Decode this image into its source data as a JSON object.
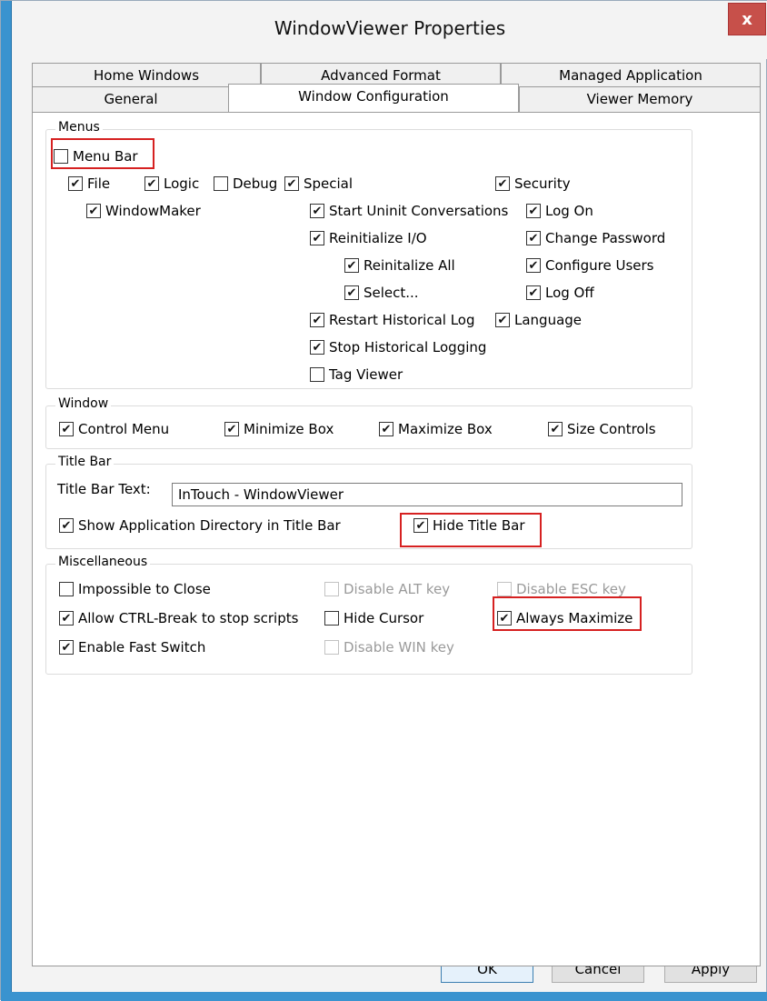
{
  "window": {
    "title": "WindowViewer Properties",
    "close_glyph": "x"
  },
  "tabs": {
    "row1": [
      "Home Windows",
      "Advanced Format",
      "Managed Application"
    ],
    "row2": [
      "General",
      "Window Configuration",
      "Viewer Memory"
    ]
  },
  "menus": {
    "legend": "Menus",
    "menu_bar": "Menu Bar",
    "file": "File",
    "logic": "Logic",
    "debug": "Debug",
    "special": "Special",
    "security": "Security",
    "window_maker": "WindowMaker",
    "start_unint": "Start Uninit Conversations",
    "reinit_io": "Reinitialize I/O",
    "reinit_all": "Reinitalize All",
    "select": "Select...",
    "restart_hist": "Restart Historical Log",
    "stop_hist": "Stop Historical Logging",
    "tag_viewer": "Tag Viewer",
    "log_on": "Log On",
    "change_password": "Change Password",
    "configure_users": "Configure Users",
    "log_off": "Log Off",
    "language": "Language"
  },
  "window_group": {
    "legend": "Window",
    "control_menu": "Control Menu",
    "minimize_box": "Minimize Box",
    "maximize_box": "Maximize Box",
    "size_controls": "Size Controls"
  },
  "titlebar_group": {
    "legend": "Title Bar",
    "text_label": "Title Bar Text:",
    "text_value": "InTouch - WindowViewer",
    "show_app_dir": "Show Application Directory in Title Bar",
    "hide_title_bar": "Hide Title Bar"
  },
  "misc": {
    "legend": "Miscellaneous",
    "impossible_close": "Impossible to Close",
    "allow_ctrl_break": "Allow CTRL-Break to stop scripts",
    "enable_fast_switch": "Enable Fast Switch",
    "disable_alt": "Disable ALT key",
    "hide_cursor": "Hide Cursor",
    "disable_win": "Disable WIN key",
    "disable_esc": "Disable ESC key",
    "always_maximize": "Always Maximize"
  },
  "buttons": {
    "ok": "OK",
    "cancel": "Cancel",
    "apply": "Apply"
  },
  "check_glyph": "✔",
  "colors": {
    "highlight": "#d62121",
    "frame_accent": "#3a93cf"
  }
}
